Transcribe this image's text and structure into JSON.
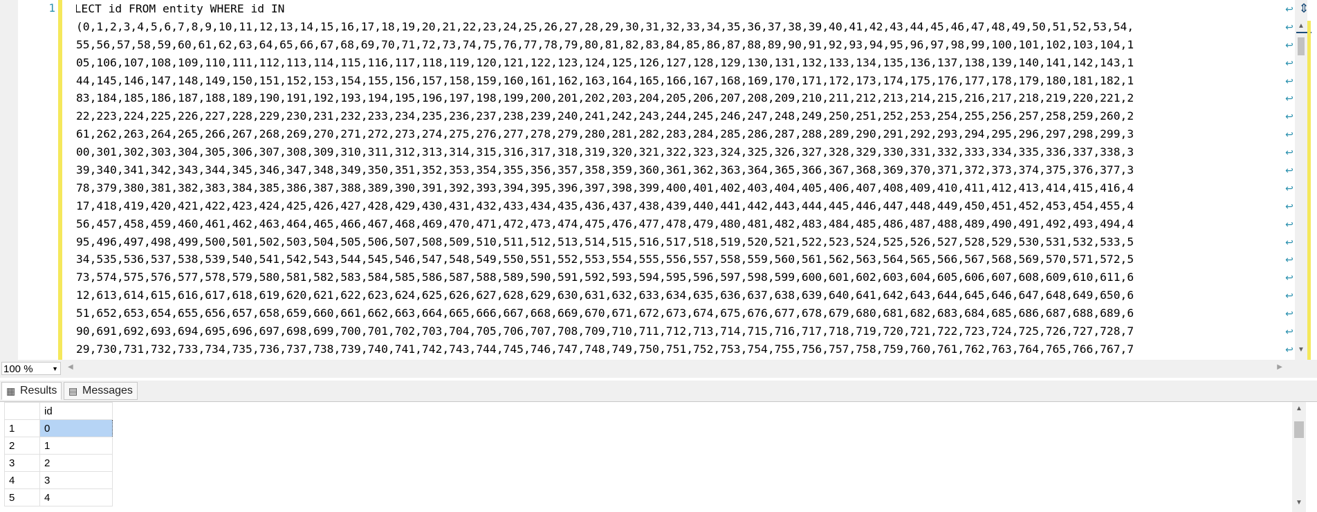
{
  "editor": {
    "line_number": "1",
    "lines": [
      "SELECT id FROM entity WHERE id IN",
      "(0,1,2,3,4,5,6,7,8,9,10,11,12,13,14,15,16,17,18,19,20,21,22,23,24,25,26,27,28,29,30,31,32,33,34,35,36,37,38,39,40,41,42,43,44,45,46,47,48,49,50,51,52,53,54,",
      "55,56,57,58,59,60,61,62,63,64,65,66,67,68,69,70,71,72,73,74,75,76,77,78,79,80,81,82,83,84,85,86,87,88,89,90,91,92,93,94,95,96,97,98,99,100,101,102,103,104,1",
      "05,106,107,108,109,110,111,112,113,114,115,116,117,118,119,120,121,122,123,124,125,126,127,128,129,130,131,132,133,134,135,136,137,138,139,140,141,142,143,1",
      "44,145,146,147,148,149,150,151,152,153,154,155,156,157,158,159,160,161,162,163,164,165,166,167,168,169,170,171,172,173,174,175,176,177,178,179,180,181,182,1",
      "83,184,185,186,187,188,189,190,191,192,193,194,195,196,197,198,199,200,201,202,203,204,205,206,207,208,209,210,211,212,213,214,215,216,217,218,219,220,221,2",
      "22,223,224,225,226,227,228,229,230,231,232,233,234,235,236,237,238,239,240,241,242,243,244,245,246,247,248,249,250,251,252,253,254,255,256,257,258,259,260,2",
      "61,262,263,264,265,266,267,268,269,270,271,272,273,274,275,276,277,278,279,280,281,282,283,284,285,286,287,288,289,290,291,292,293,294,295,296,297,298,299,3",
      "00,301,302,303,304,305,306,307,308,309,310,311,312,313,314,315,316,317,318,319,320,321,322,323,324,325,326,327,328,329,330,331,332,333,334,335,336,337,338,3",
      "39,340,341,342,343,344,345,346,347,348,349,350,351,352,353,354,355,356,357,358,359,360,361,362,363,364,365,366,367,368,369,370,371,372,373,374,375,376,377,3",
      "78,379,380,381,382,383,384,385,386,387,388,389,390,391,392,393,394,395,396,397,398,399,400,401,402,403,404,405,406,407,408,409,410,411,412,413,414,415,416,4",
      "17,418,419,420,421,422,423,424,425,426,427,428,429,430,431,432,433,434,435,436,437,438,439,440,441,442,443,444,445,446,447,448,449,450,451,452,453,454,455,4",
      "56,457,458,459,460,461,462,463,464,465,466,467,468,469,470,471,472,473,474,475,476,477,478,479,480,481,482,483,484,485,486,487,488,489,490,491,492,493,494,4",
      "95,496,497,498,499,500,501,502,503,504,505,506,507,508,509,510,511,512,513,514,515,516,517,518,519,520,521,522,523,524,525,526,527,528,529,530,531,532,533,5",
      "34,535,536,537,538,539,540,541,542,543,544,545,546,547,548,549,550,551,552,553,554,555,556,557,558,559,560,561,562,563,564,565,566,567,568,569,570,571,572,5",
      "73,574,575,576,577,578,579,580,581,582,583,584,585,586,587,588,589,590,591,592,593,594,595,596,597,598,599,600,601,602,603,604,605,606,607,608,609,610,611,6",
      "12,613,614,615,616,617,618,619,620,621,622,623,624,625,626,627,628,629,630,631,632,633,634,635,636,637,638,639,640,641,642,643,644,645,646,647,648,649,650,6",
      "51,652,653,654,655,656,657,658,659,660,661,662,663,664,665,666,667,668,669,670,671,672,673,674,675,676,677,678,679,680,681,682,683,684,685,686,687,688,689,6",
      "90,691,692,693,694,695,696,697,698,699,700,701,702,703,704,705,706,707,708,709,710,711,712,713,714,715,716,717,718,719,720,721,722,723,724,725,726,727,728,7",
      "29,730,731,732,733,734,735,736,737,738,739,740,741,742,743,744,745,746,747,748,749,750,751,752,753,754,755,756,757,758,759,760,761,762,763,764,765,766,767,7"
    ]
  },
  "statusbar": {
    "zoom": "100 %"
  },
  "tabs": {
    "results": "Results",
    "messages": "Messages"
  },
  "results": {
    "column": "id",
    "rows": [
      {
        "n": "1",
        "id": "0"
      },
      {
        "n": "2",
        "id": "1"
      },
      {
        "n": "3",
        "id": "2"
      },
      {
        "n": "4",
        "id": "3"
      },
      {
        "n": "5",
        "id": "4"
      }
    ]
  },
  "colors": {
    "line_number": "#2b91af",
    "change_bar": "#f5e85c",
    "selected_cell": "#b6d4f5"
  }
}
